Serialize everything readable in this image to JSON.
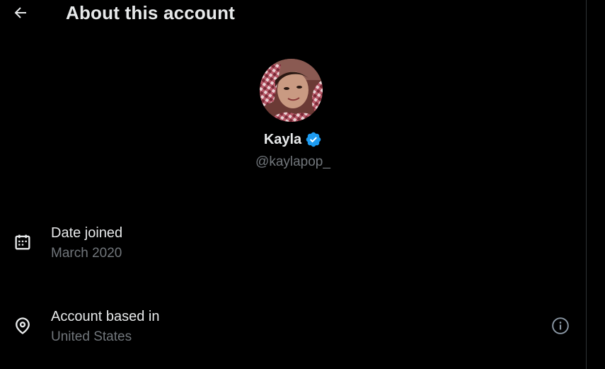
{
  "header": {
    "title": "About this account",
    "back_icon": "arrow-left-icon"
  },
  "profile": {
    "name": "Kayla",
    "handle": "@kaylapop_",
    "verified": true,
    "verified_color": "#1d9bf0",
    "avatar_icon": "profile-photo"
  },
  "details": [
    {
      "icon": "calendar-icon",
      "label": "Date joined",
      "value": "March 2020"
    },
    {
      "icon": "location-pin-icon",
      "label": "Account based in",
      "value": "United States",
      "info_icon": "info-circle-icon"
    }
  ],
  "colors": {
    "background": "#000000",
    "primary_text": "#e7e9ea",
    "secondary_text": "#71767b",
    "accent": "#1d9bf0"
  }
}
